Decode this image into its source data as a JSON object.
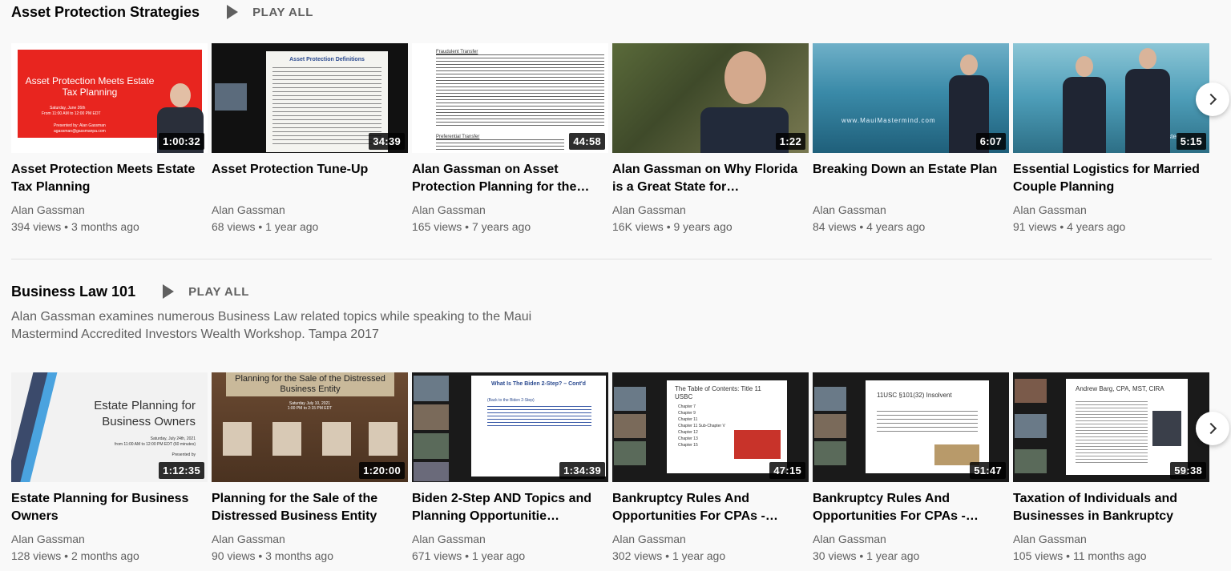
{
  "shelves": [
    {
      "title": "Asset Protection Strategies",
      "play_all": "PLAY ALL",
      "description": "",
      "videos": [
        {
          "title": "Asset Protection Meets Estate Tax Planning",
          "channel": "Alan Gassman",
          "views": "394 views",
          "age": "3 months ago",
          "duration": "1:00:32",
          "thumb_heading": "Asset Protection Meets Estate Tax Planning",
          "thumb_lines": [
            "Saturday, June 26th",
            "From 11:00 AM to 12:00 PM EDT",
            "Presented by: Alan Gassman",
            "agassman@gassmanpa.com"
          ]
        },
        {
          "title": "Asset Protection Tune-Up",
          "channel": "Alan Gassman",
          "views": "68 views",
          "age": "1 year ago",
          "duration": "34:39",
          "thumb_heading": "Asset Protection Definitions"
        },
        {
          "title": "Alan Gassman on Asset Protection Planning for the…",
          "channel": "Alan Gassman",
          "views": "165 views",
          "age": "7 years ago",
          "duration": "44:58",
          "thumb_lines": [
            "Fraudulent Transfer",
            "Preferential Transfer"
          ]
        },
        {
          "title": "Alan Gassman on Why Florida is a Great State for…",
          "channel": "Alan Gassman",
          "views": "16K views",
          "age": "9 years ago",
          "duration": "1:22"
        },
        {
          "title": "Breaking Down an Estate Plan",
          "channel": "Alan Gassman",
          "views": "84 views",
          "age": "4 years ago",
          "duration": "6:07",
          "thumb_lines": [
            "www.MauiMastermind.com"
          ]
        },
        {
          "title": "Essential Logistics for Married Couple Planning",
          "channel": "Alan Gassman",
          "views": "91 views",
          "age": "4 years ago",
          "duration": "5:15",
          "thumb_lines": [
            "Master"
          ]
        }
      ]
    },
    {
      "title": "Business Law 101",
      "play_all": "PLAY ALL",
      "description": "Alan Gassman examines numerous Business Law related topics while speaking to the Maui Mastermind Accredited Investors Wealth Workshop. Tampa 2017",
      "videos": [
        {
          "title": "Estate Planning for Business Owners",
          "channel": "Alan Gassman",
          "views": "128 views",
          "age": "2 months ago",
          "duration": "1:12:35",
          "thumb_heading": "Estate Planning for Business Owners",
          "thumb_lines": [
            "Saturday, July 24th, 2021",
            "from 11:00 AM to 12:00 PM EDT (60 minutes)",
            "Presented by"
          ]
        },
        {
          "title": "Planning for the Sale of the Distressed Business Entity",
          "channel": "Alan Gassman",
          "views": "90 views",
          "age": "3 months ago",
          "duration": "1:20:00",
          "thumb_heading": "Planning for the Sale of the Distressed Business Entity",
          "thumb_lines": [
            "Saturday July 10, 2021",
            "1:00 PM to 2:15 PM EDT"
          ]
        },
        {
          "title": "Biden 2-Step AND Topics and Planning Opportunitie…",
          "channel": "Alan Gassman",
          "views": "671 views",
          "age": "1 year ago",
          "duration": "1:34:39",
          "thumb_heading": "What Is The Biden 2-Step? – Cont'd",
          "thumb_lines": [
            "(Back to the Biden 2-Step)"
          ]
        },
        {
          "title": "Bankruptcy Rules And Opportunities For CPAs -…",
          "channel": "Alan Gassman",
          "views": "302 views",
          "age": "1 year ago",
          "duration": "47:15",
          "thumb_heading": "The Table of Contents: Title 11 USBC",
          "thumb_lines": [
            "Chapter 7",
            "Chapter 9",
            "Chapter 11",
            "Chapter 11 Sub-Chapter V",
            "Chapter 12",
            "Chapter 13",
            "Chapter 15"
          ]
        },
        {
          "title": "Bankruptcy Rules And Opportunities For CPAs -…",
          "channel": "Alan Gassman",
          "views": "30 views",
          "age": "1 year ago",
          "duration": "51:47",
          "thumb_heading": "11USC §101(32) Insolvent"
        },
        {
          "title": "Taxation of Individuals and Businesses in Bankruptcy",
          "channel": "Alan Gassman",
          "views": "105 views",
          "age": "11 months ago",
          "duration": "59:38",
          "thumb_heading": "Andrew Barg, CPA, MST, CIRA"
        }
      ]
    }
  ],
  "separator": "•",
  "colors": {
    "accent_red": "#e8251f",
    "text_secondary": "#606060",
    "background": "#f9f9f9"
  }
}
